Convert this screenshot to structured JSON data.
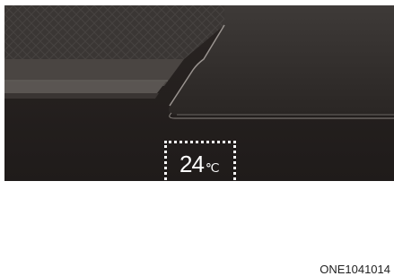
{
  "display": {
    "temperature_value": "24",
    "temperature_unit": "℃"
  },
  "figure_code": "ONE1041014"
}
